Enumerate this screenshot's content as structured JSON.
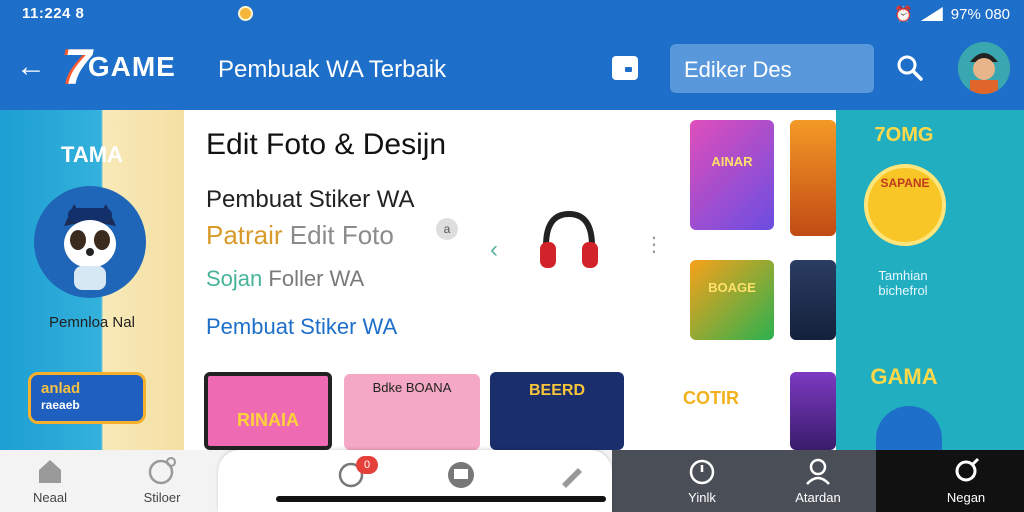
{
  "status_bar": {
    "time": "11:224 8",
    "battery": "97% 080"
  },
  "app_bar": {
    "logo_number": "7",
    "logo_text": "GAME",
    "title": "Pembuak WA Terbaik",
    "search_value": "Ediker Des"
  },
  "left_panel": {
    "heading": "TAMA",
    "caption": "Pemnloa Nal",
    "promo_line1": "anlad",
    "promo_line2": "raeaeb"
  },
  "main": {
    "title": "Edit Foto & Desijn",
    "subtitle": "Pembuat Stiker WA",
    "line2_orange": "Patrair",
    "line2_rest": " Edit Foto",
    "line3_green": "Sojan",
    "line3_rest": " Foller WA",
    "line4": "Pembuat Stiker WA",
    "tiles": [
      {
        "title": "AINAR"
      },
      {
        "title": "BOAGE"
      },
      {
        "title": "RINAIA"
      },
      {
        "title": "Bdke BOANA"
      },
      {
        "title": "BEERD"
      },
      {
        "title": "COTIR"
      }
    ]
  },
  "right_panel": {
    "heading_top": "7OMG",
    "ring_label": "SAPANE",
    "caption_line1": "Tamhian",
    "caption_line2": "bichefrol",
    "heading_bottom": "GAMA"
  },
  "bottom_nav": {
    "items": [
      {
        "label": "Neaal",
        "icon": "home-icon"
      },
      {
        "label": "Stiloer",
        "icon": "sticker-icon"
      },
      {
        "label": "Yinlk",
        "icon": "timer-icon"
      },
      {
        "label": "Atardan",
        "icon": "profile-icon"
      },
      {
        "label": "Negan",
        "icon": "settings-icon"
      }
    ],
    "badge": "0"
  },
  "colors": {
    "primary": "#1d6fc9",
    "accent_orange": "#d89a2a",
    "accent_green": "#47b39a",
    "teal_panel": "#22aec1"
  }
}
